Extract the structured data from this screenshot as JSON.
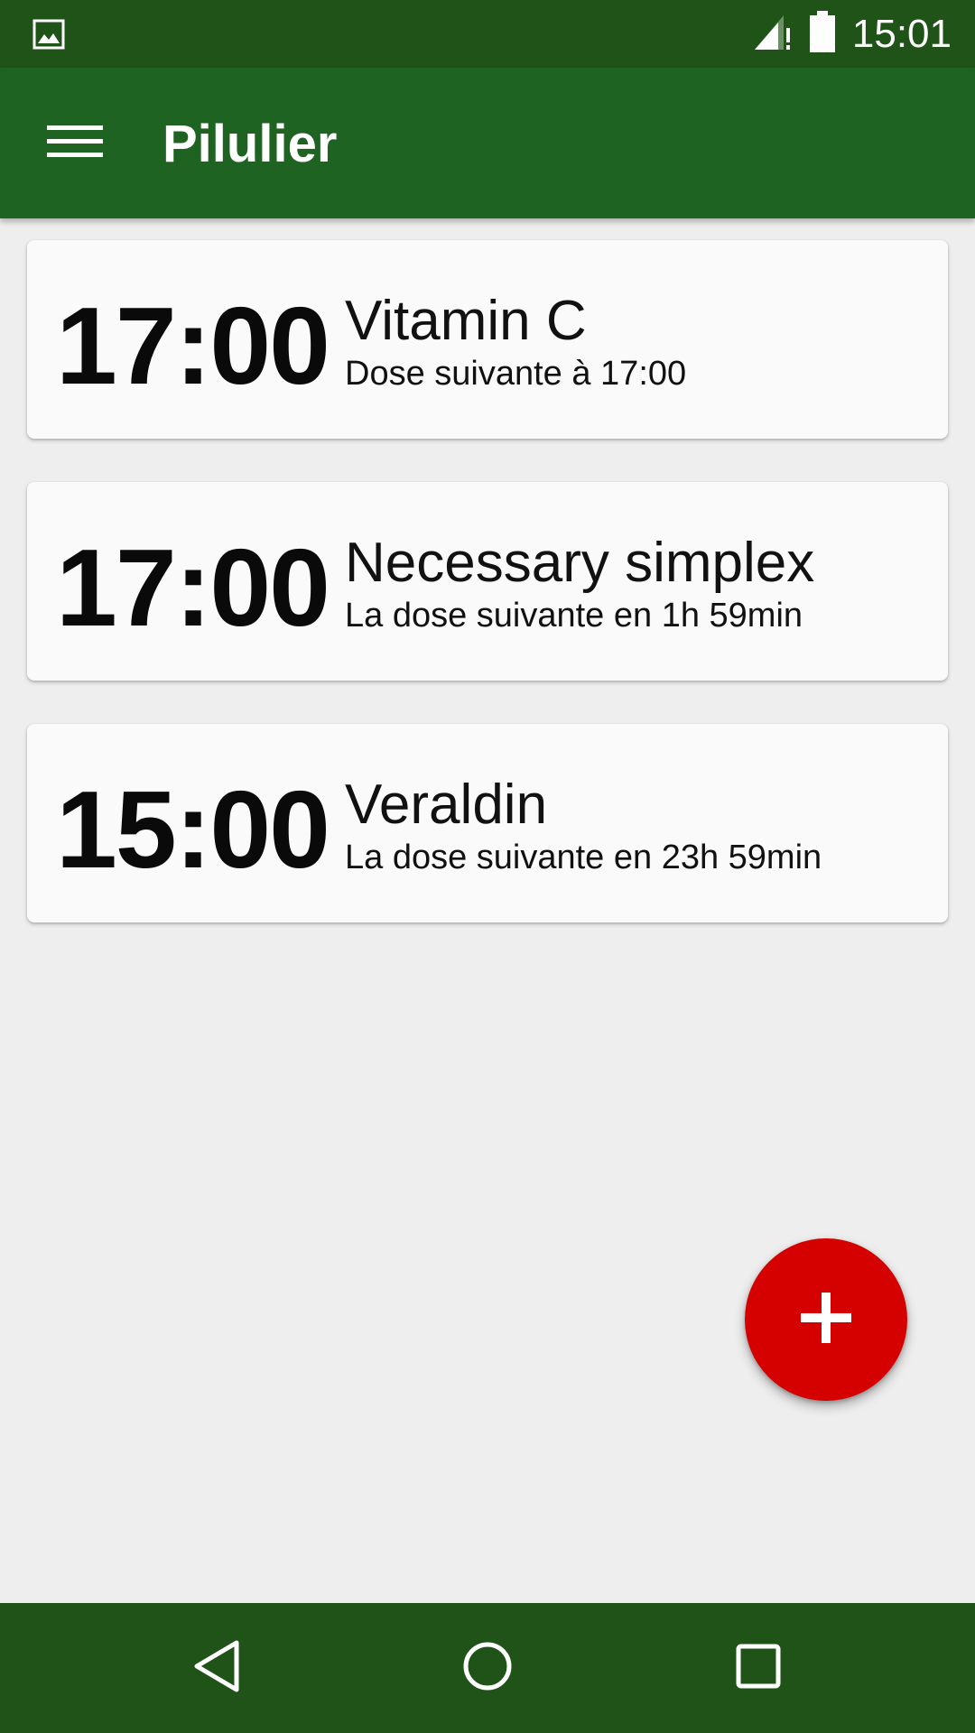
{
  "status_bar": {
    "time": "15:01",
    "icons": [
      "image-icon",
      "signal-icon",
      "battery-icon"
    ]
  },
  "app_bar": {
    "title": "Pilulier",
    "menu_icon": "menu-icon"
  },
  "medications": [
    {
      "time": "17:00",
      "name": "Vitamin C",
      "subtitle": "Dose suivante à 17:00"
    },
    {
      "time": "17:00",
      "name": "Necessary simplex",
      "subtitle": "La dose suivante en 1h 59min"
    },
    {
      "time": "15:00",
      "name": "Veraldin",
      "subtitle": "La dose suivante en 23h 59min"
    }
  ],
  "fab": {
    "icon": "plus-icon"
  },
  "nav_bar": {
    "icons": [
      "back-icon",
      "home-icon",
      "recents-icon"
    ]
  },
  "colors": {
    "status_bar": "#1f5317",
    "app_bar": "#1f6322",
    "fab": "#d50000",
    "background": "#eeeeee",
    "card": "#fafafa"
  }
}
